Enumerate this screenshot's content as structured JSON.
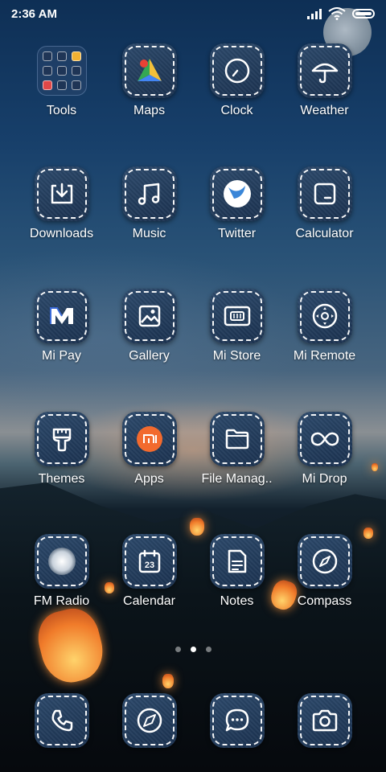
{
  "status_bar": {
    "time": "2:36 AM"
  },
  "apps": [
    {
      "label": "Tools"
    },
    {
      "label": "Maps"
    },
    {
      "label": "Clock"
    },
    {
      "label": "Weather"
    },
    {
      "label": "Downloads"
    },
    {
      "label": "Music"
    },
    {
      "label": "Twitter"
    },
    {
      "label": "Calculator"
    },
    {
      "label": "Mi Pay"
    },
    {
      "label": "Gallery"
    },
    {
      "label": "Mi Store"
    },
    {
      "label": "Mi Remote"
    },
    {
      "label": "Themes"
    },
    {
      "label": "Apps"
    },
    {
      "label": "File Manag.."
    },
    {
      "label": "Mi Drop"
    },
    {
      "label": "FM Radio"
    },
    {
      "label": "Calendar",
      "icon_text": "23"
    },
    {
      "label": "Notes"
    },
    {
      "label": "Compass"
    }
  ],
  "dock": [
    {
      "icon": "phone-icon"
    },
    {
      "icon": "browser-icon"
    },
    {
      "icon": "messaging-icon"
    },
    {
      "icon": "camera-icon"
    }
  ],
  "page_indicator": {
    "pages": 3,
    "active": 2
  },
  "colors": {
    "tile": "#233f60",
    "label": "#ffffff"
  }
}
